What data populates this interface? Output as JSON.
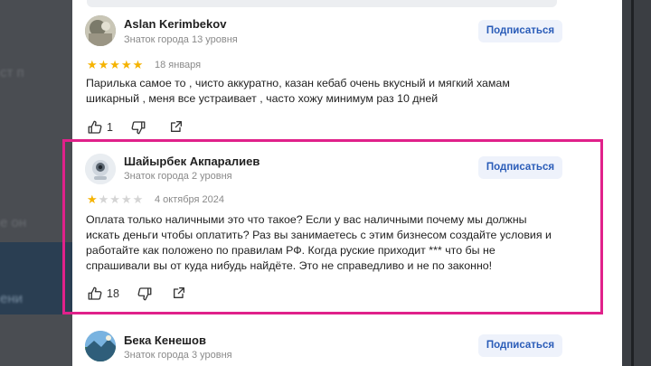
{
  "background": {
    "blurred_lines": [
      "ст п",
      "е он",
      "ени"
    ]
  },
  "reviews": [
    {
      "name": "Aslan Kerimbekov",
      "level": "Знаток города 13 уровня",
      "subscribe_label": "Подписаться",
      "rating": 5,
      "stars": "★★★★★",
      "date": "18 января",
      "text": "Парилька самое то , чисто аккуратно, казан кебаб очень вкусный и мягкий хамам шикарный , меня все устраивает , часто хожу минимум раз 10 дней",
      "likes": "1"
    },
    {
      "name": "Шайырбек Акпаралиев",
      "level": "Знаток города 2 уровня",
      "subscribe_label": "Подписаться",
      "rating": 1,
      "stars_on": "★",
      "stars_off": "★★★★",
      "date": "4 октября 2024",
      "text": "Оплата только наличными это что такое? Если у вас наличными почему мы должны искать деньги чтобы оплатить? Раз вы занимаетесь с этим бизнесом создайте условия и работайте как положено по правилам РФ. Когда руские приходит *** что бы не спрашивали вы от куда нибудь найдёте. Это не справедливо и не по законно!",
      "likes": "18"
    },
    {
      "name": "Бека Кенешов",
      "level": "Знаток города 3 уровня",
      "subscribe_label": "Подписаться"
    }
  ],
  "colors": {
    "highlight": "#e0218a",
    "star": "#f5b301",
    "subscribe_text": "#2a5cb8"
  }
}
